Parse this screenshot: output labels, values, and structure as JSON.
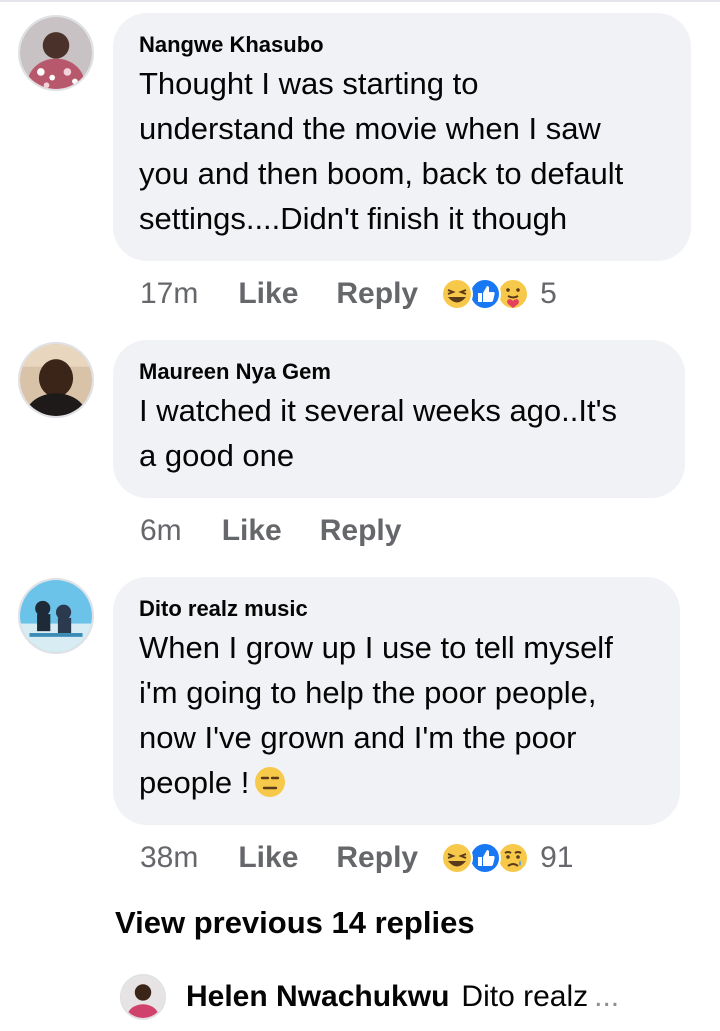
{
  "comments": [
    {
      "author": "Nangwe Khasubo",
      "lines": [
        "Thought I was starting to",
        "understand the movie when I saw",
        "you and then boom, back to default",
        "settings....Didn't finish it though"
      ],
      "time": "17m",
      "like_label": "Like",
      "reply_label": "Reply",
      "reactions": [
        "laughing-emoji-icon",
        "like-reaction-icon",
        "care-reaction-icon"
      ],
      "reaction_count": "5"
    },
    {
      "author": "Maureen Nya Gem",
      "lines": [
        "I watched it several weeks ago..It's",
        "a good one"
      ],
      "time": "6m",
      "like_label": "Like",
      "reply_label": "Reply"
    },
    {
      "author": "Dito realz music",
      "lines": [
        "When I grow up I use to tell myself",
        "i'm going to help the poor people,",
        "now I've grown and I'm the poor",
        "people !"
      ],
      "inline_emoji": "expressionless-face-icon",
      "time": "38m",
      "like_label": "Like",
      "reply_label": "Reply",
      "reactions": [
        "laughing-emoji-icon",
        "like-reaction-icon",
        "sad-reaction-icon"
      ],
      "reaction_count": "91"
    }
  ],
  "view_previous": "View previous 14 replies",
  "reply_preview": {
    "author": "Helen Nwachukwu",
    "text": "Dito realz",
    "ellipsis": "..."
  },
  "colors": {
    "bubble": "#f0f2f5",
    "meta_text": "#65676b",
    "like_blue": "#1877f2",
    "emoji_yellow": "#f7c94b"
  }
}
